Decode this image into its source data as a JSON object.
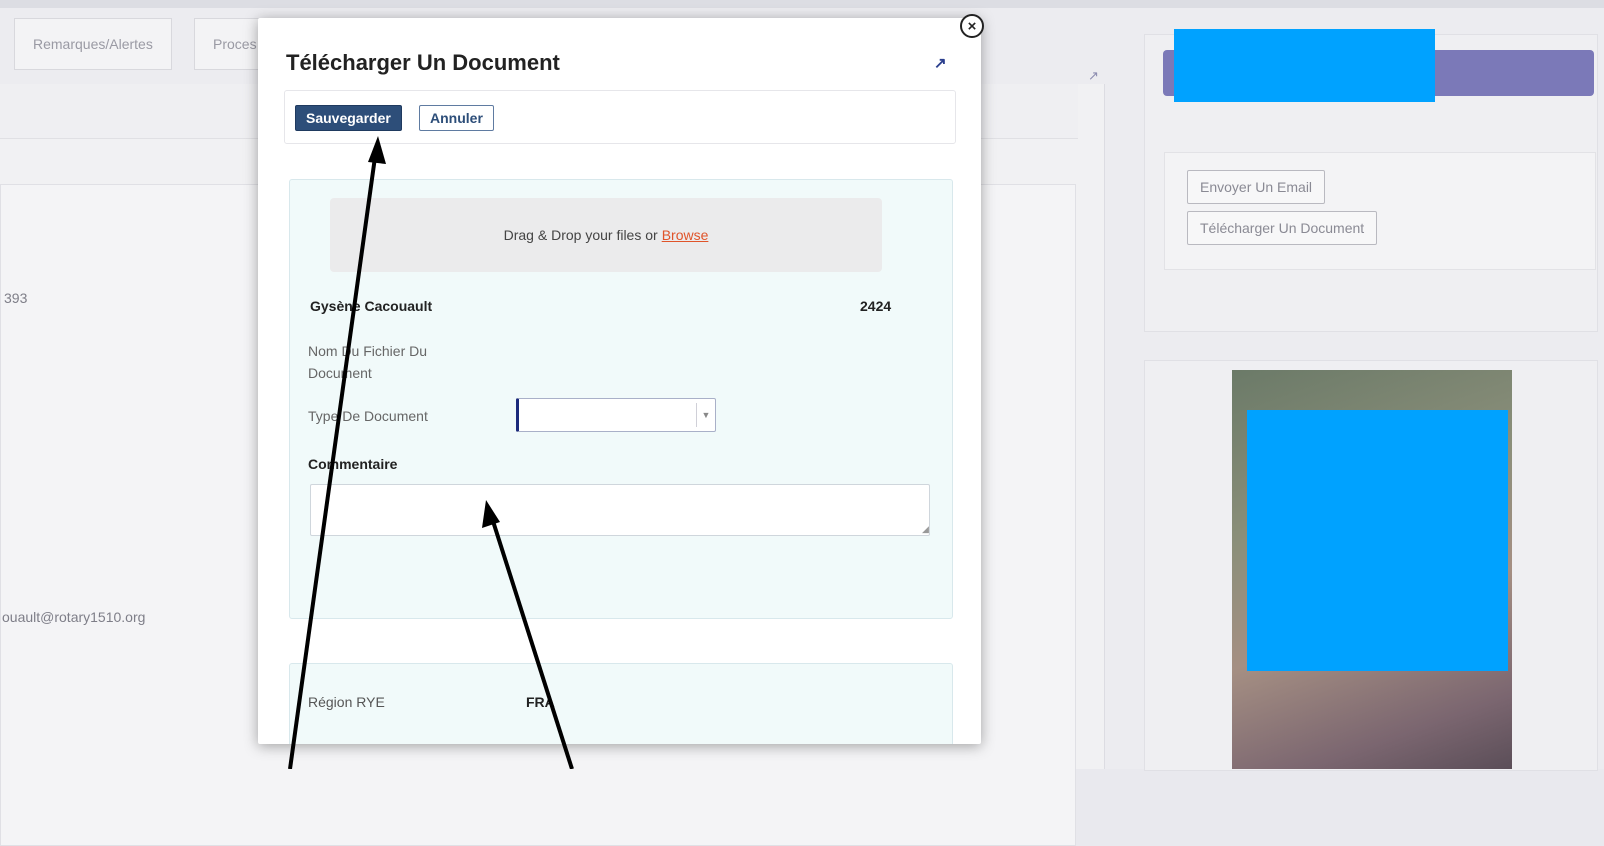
{
  "background": {
    "tabs": [
      "Remarques/Alertes",
      "Proces"
    ],
    "left_texts": [
      "393",
      "ouault@rotary1510.org"
    ],
    "right_actions": {
      "email_button": "Envoyer Un Email",
      "upload_button": "Télécharger Un Document"
    }
  },
  "modal": {
    "title": "Télécharger Un Document",
    "close_icon": "×",
    "expand_icon": "↗",
    "toolbar": {
      "save_label": "Sauvegarder",
      "cancel_label": "Annuler"
    },
    "dropzone": {
      "text": "Drag & Drop your files or",
      "browse_label": "Browse"
    },
    "member": {
      "name": "Gysène Cacouault",
      "id": "2424"
    },
    "fields": {
      "filename_label": "Nom Du Fichier Du Document",
      "doctype_label": "Type De Document",
      "doctype_value": "",
      "comment_label": "Commentaire",
      "comment_value": ""
    },
    "region": {
      "label": "Région RYE",
      "value": "FRA"
    }
  },
  "colors": {
    "primary": "#2d4e79",
    "header_band": "#7b79b8",
    "redaction": "#00a2ff",
    "browse_link": "#e0542a",
    "panel_bg": "#f1fafa"
  }
}
